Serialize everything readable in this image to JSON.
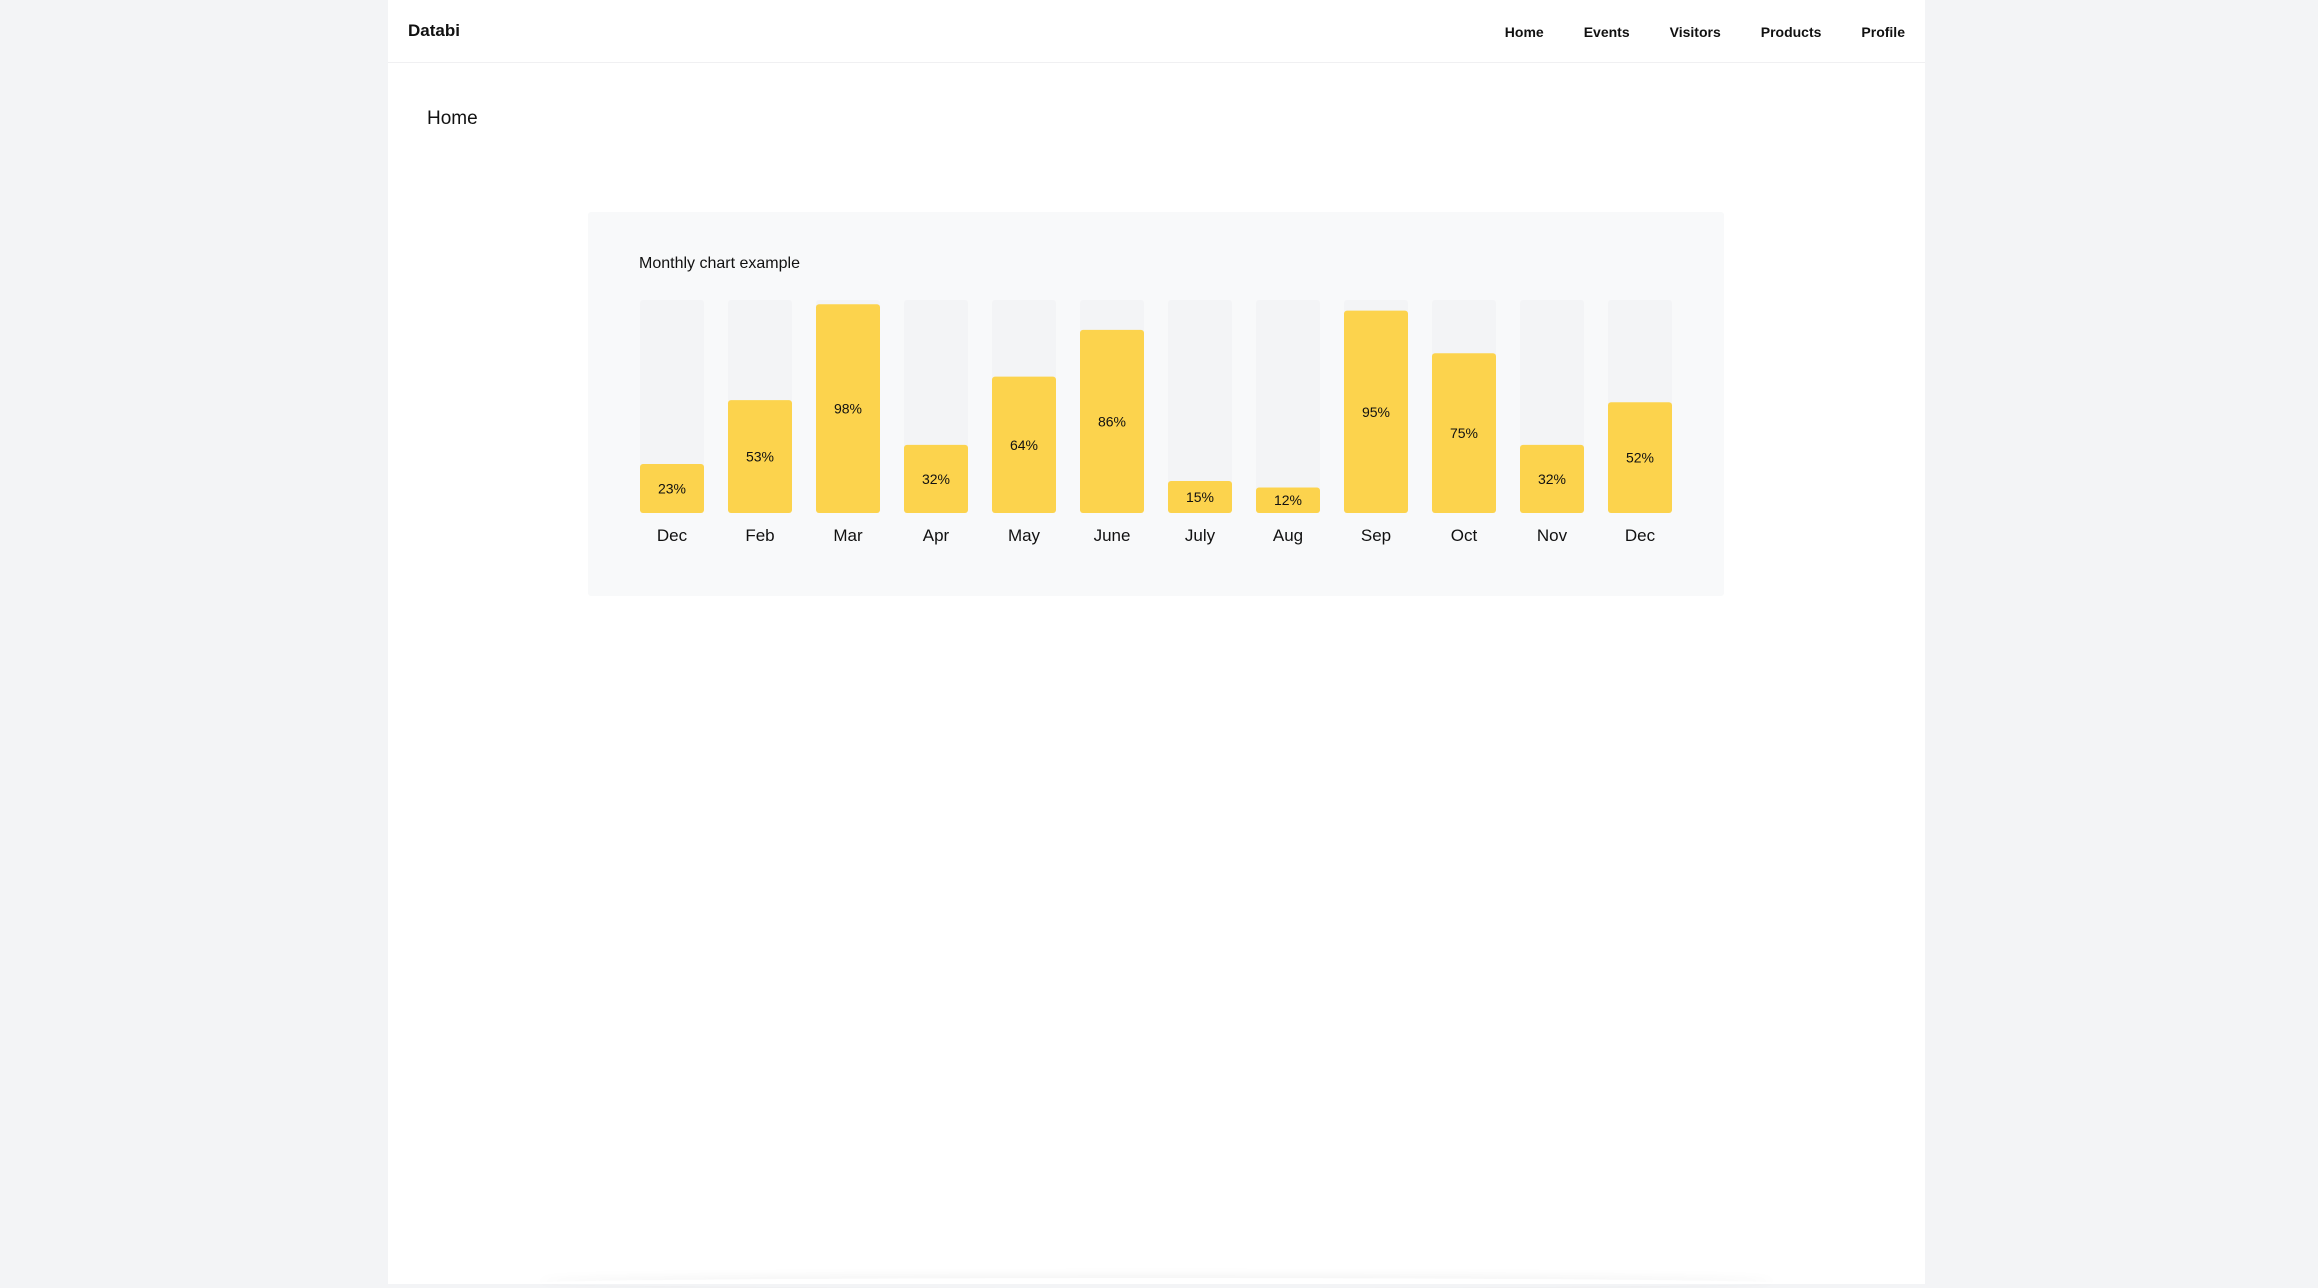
{
  "app": {
    "brand": "Databi"
  },
  "nav": {
    "items": [
      {
        "label": "Home"
      },
      {
        "label": "Events"
      },
      {
        "label": "Visitors"
      },
      {
        "label": "Products"
      },
      {
        "label": "Profile"
      }
    ]
  },
  "page": {
    "title": "Home"
  },
  "colors": {
    "bar_fill": "#fcd34d",
    "bar_track": "#f3f4f6",
    "card_bg": "#f8f9fa"
  },
  "chart_data": {
    "type": "bar",
    "title": "Monthly chart example",
    "categories": [
      "Dec",
      "Feb",
      "Mar",
      "Apr",
      "May",
      "June",
      "July",
      "Aug",
      "Sep",
      "Oct",
      "Nov",
      "Dec"
    ],
    "values": [
      23,
      53,
      98,
      32,
      64,
      86,
      15,
      12,
      95,
      75,
      32,
      52
    ],
    "value_suffix": "%",
    "ylim": [
      0,
      100
    ],
    "grid": false,
    "legend": "none"
  }
}
